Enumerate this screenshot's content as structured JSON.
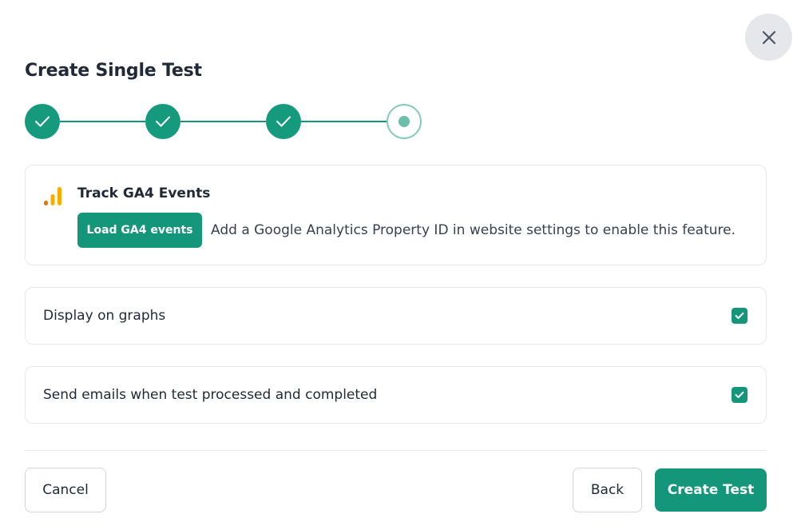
{
  "dialog": {
    "title": "Create Single Test",
    "close_icon": "close-icon"
  },
  "stepper": {
    "steps": [
      {
        "state": "completed",
        "icon": "check-icon"
      },
      {
        "state": "completed",
        "icon": "check-icon"
      },
      {
        "state": "completed",
        "icon": "check-icon"
      },
      {
        "state": "current",
        "icon": "dot-icon"
      }
    ],
    "accent_color": "#14967a"
  },
  "ga4": {
    "icon": "google-analytics-icon",
    "title": "Track GA4 Events",
    "load_button_label": "Load GA4 events",
    "note": "Add a Google Analytics Property ID in website settings to enable this feature."
  },
  "options": [
    {
      "label": "Display on graphs",
      "checked": true
    },
    {
      "label": "Send emails when test processed and completed",
      "checked": true
    }
  ],
  "footer": {
    "cancel_label": "Cancel",
    "back_label": "Back",
    "create_label": "Create Test"
  },
  "colors": {
    "primary": "#14967a",
    "border": "#e5e7eb",
    "close_bg": "#e5e7eb"
  }
}
